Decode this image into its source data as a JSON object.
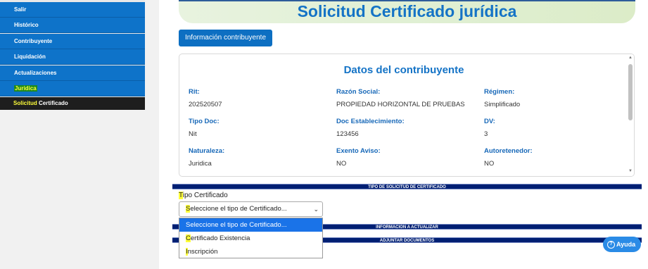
{
  "sidebar": {
    "items": [
      {
        "label": "Salir"
      },
      {
        "label": "Histórico"
      },
      {
        "label": "Contribuyente"
      },
      {
        "label": "Liquidación"
      },
      {
        "label": "Actualizaciones"
      },
      {
        "label": "Juridica"
      }
    ],
    "sub_item": {
      "prefix": "Solicitud",
      "rest": " Certificado"
    }
  },
  "header": {
    "title": "Solicitud Certificado jurídica"
  },
  "info_button": {
    "label": "Información contribuyente"
  },
  "taxpayer": {
    "title": "Datos del contribuyente",
    "fields": {
      "rit": {
        "label": "Rit:",
        "value": "202520507"
      },
      "razon": {
        "label": "Razón Social:",
        "value": "PROPIEDAD HORIZONTAL DE PRUEBAS"
      },
      "regimen": {
        "label": "Régimen:",
        "value": "Simplificado"
      },
      "tipo_doc": {
        "label": "Tipo Doc:",
        "value": "Nit"
      },
      "doc_est": {
        "label": "Doc Establecimiento:",
        "value": "123456"
      },
      "dv": {
        "label": "DV:",
        "value": "3"
      },
      "naturaleza": {
        "label": "Naturaleza:",
        "value": "Juridica"
      },
      "exento": {
        "label": "Exento Aviso:",
        "value": "NO"
      },
      "autoret": {
        "label": "Autoretenedor:",
        "value": "NO"
      }
    }
  },
  "sections": {
    "tipo_solicitud": "TIPO DE SOLICITUD DE CERTIFICADO",
    "actualizar": "INFORMACION A ACTUALIZAR",
    "adjuntar": "ADJUNTAR DOCUMENTOS"
  },
  "form": {
    "tipo_label_first": "T",
    "tipo_label_rest": "ipo Certificado",
    "select_first": "S",
    "select_rest": "eleccione el tipo de Certificado...",
    "options": [
      {
        "first": "",
        "rest": "Seleccione el tipo de Certificado..."
      },
      {
        "first": "C",
        "rest": "ertificado Existencia"
      },
      {
        "first": "I",
        "rest": "nscripción"
      }
    ]
  },
  "help": {
    "label": "Ayuda"
  },
  "colors": {
    "primary": "#0e73c9",
    "band": "#001f73",
    "highlight": "#ffff3a"
  }
}
